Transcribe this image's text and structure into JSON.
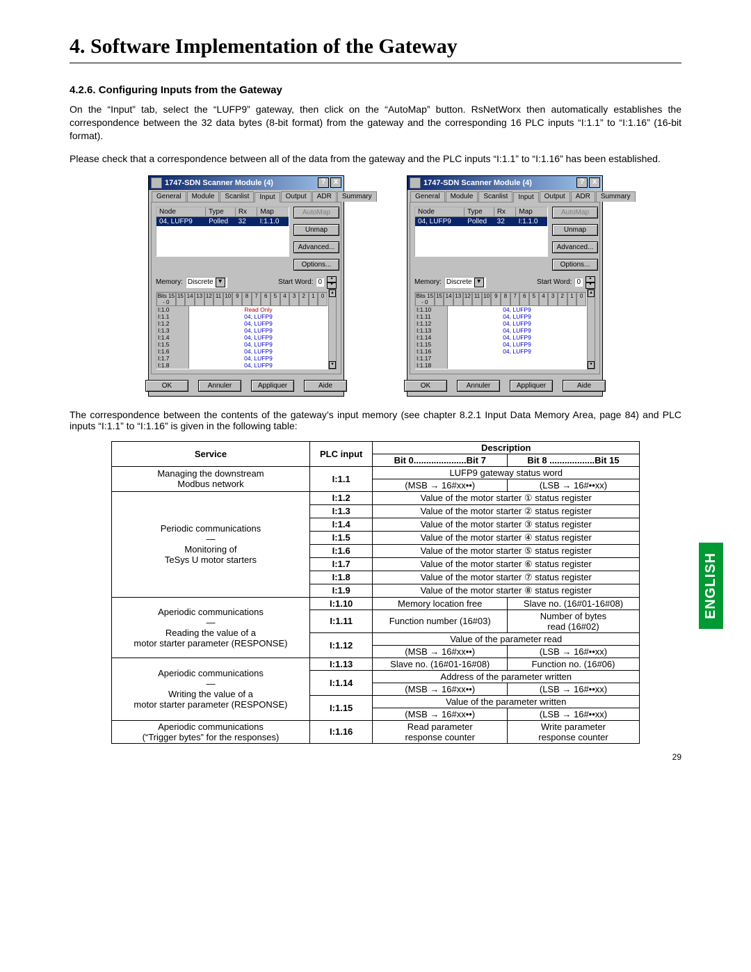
{
  "page_title": "4. Software Implementation of the Gateway",
  "section_title": "4.2.6. Configuring Inputs from the Gateway",
  "para1": "On the “Input” tab, select the “LUFP9” gateway, then click on the “AutoMap” button. RsNetWorx then automatically establishes the correspondence between the 32 data bytes (8-bit format) from the gateway and the corresponding 16 PLC inputs “I:1.1” to “I:1.16” (16-bit format).",
  "para2": "Please check that a correspondence between all of the data from the gateway and the PLC inputs “I:1.1” to “I:1.16” has been established.",
  "dialog_title": "1747-SDN Scanner Module (4)",
  "tabs": [
    "General",
    "Module",
    "Scanlist",
    "Input",
    "Output",
    "ADR",
    "Summary"
  ],
  "node_headers": [
    "Node",
    "Type",
    "Rx",
    "Map"
  ],
  "node_row": [
    "04, LUFP9",
    "Polled",
    "32",
    "I:1.1.0"
  ],
  "side_buttons": [
    "AutoMap",
    "Unmap",
    "Advanced...",
    "Options..."
  ],
  "memory_label": "Memory:",
  "memory_value": "Discrete",
  "startword_label": "Start Word:",
  "startword_value": "0",
  "bits_label": "Bits 15 - 0",
  "bits_cols": [
    "15",
    "14",
    "13",
    "12",
    "11",
    "10",
    "9",
    "8",
    "7",
    "6",
    "5",
    "4",
    "3",
    "2",
    "1",
    "0"
  ],
  "grid_left": [
    {
      "lab": "I:1.0",
      "val": "Read Only",
      "ro": true
    },
    {
      "lab": "I:1.1",
      "val": "04, LUFP9"
    },
    {
      "lab": "I:1.2",
      "val": "04, LUFP9"
    },
    {
      "lab": "I:1.3",
      "val": "04, LUFP9"
    },
    {
      "lab": "I:1.4",
      "val": "04, LUFP9"
    },
    {
      "lab": "I:1.5",
      "val": "04, LUFP9"
    },
    {
      "lab": "I:1.6",
      "val": "04, LUFP9"
    },
    {
      "lab": "I:1.7",
      "val": "04, LUFP9"
    },
    {
      "lab": "I:1.8",
      "val": "04, LUFP9"
    }
  ],
  "grid_right": [
    {
      "lab": "I:1.10",
      "val": "04, LUFP9"
    },
    {
      "lab": "I:1.11",
      "val": "04, LUFP9"
    },
    {
      "lab": "I:1.12",
      "val": "04, LUFP9"
    },
    {
      "lab": "I:1.13",
      "val": "04, LUFP9"
    },
    {
      "lab": "I:1.14",
      "val": "04, LUFP9"
    },
    {
      "lab": "I:1.15",
      "val": "04, LUFP9"
    },
    {
      "lab": "I:1.16",
      "val": "04, LUFP9"
    },
    {
      "lab": "I:1.17",
      "val": "",
      "empty": true
    },
    {
      "lab": "I:1.18",
      "val": "",
      "empty": true
    }
  ],
  "dlg_buttons": [
    "OK",
    "Annuler",
    "Appliquer",
    "Aide"
  ],
  "caption": "The correspondence between the contents of the gateway’s input memory (see chapter 8.2.1 Input Data Memory Area, page 84) and PLC inputs “I:1.1” to “I:1.16” is given in the following table:",
  "tbl": {
    "service_h": "Service",
    "plc_h": "PLC input",
    "desc_h": "Description",
    "bit07": "Bit 0.....................Bit 7",
    "bit815": "Bit 8 ..................Bit 15",
    "r1_svc": "Managing the downstream\nModbus network",
    "r1_plc": "I:1.1",
    "r1_top": "LUFP9 gateway status word",
    "r1_l": "(MSB → 16#xx••)",
    "r1_r": "(LSB → 16#••xx)",
    "r2_svc": "Periodic communications\n—\nMonitoring of\nTeSys U motor starters",
    "r2": [
      {
        "plc": "I:1.2",
        "d": "Value of the motor starter ① status register"
      },
      {
        "plc": "I:1.3",
        "d": "Value of the motor starter ② status register"
      },
      {
        "plc": "I:1.4",
        "d": "Value of the motor starter ③ status register"
      },
      {
        "plc": "I:1.5",
        "d": "Value of the motor starter ④ status register"
      },
      {
        "plc": "I:1.6",
        "d": "Value of the motor starter ⑤ status register"
      },
      {
        "plc": "I:1.7",
        "d": "Value of the motor starter ⑥ status register"
      },
      {
        "plc": "I:1.8",
        "d": "Value of the motor starter ⑦ status register"
      },
      {
        "plc": "I:1.9",
        "d": "Value of the motor starter ⑧ status register"
      }
    ],
    "r3_svc": "Aperiodic communications\n—\nReading the value of a\nmotor starter parameter (RESPONSE)",
    "r3_10_l": "Memory location free",
    "r3_10_r": "Slave no. (16#01-16#08)",
    "r3_10_plc": "I:1.10",
    "r3_11_l": "Function number (16#03)",
    "r3_11_r": "Number of bytes\nread (16#02)",
    "r3_11_plc": "I:1.11",
    "r3_12_top": "Value of the parameter read",
    "r3_12_plc": "I:1.12",
    "r3_12_l": "(MSB → 16#xx••)",
    "r3_12_r": "(LSB → 16#••xx)",
    "r4_svc": "Aperiodic communications\n—\nWriting the value of a\nmotor starter parameter (RESPONSE)",
    "r4_13_l": "Slave no. (16#01-16#08)",
    "r4_13_r": "Function no. (16#06)",
    "r4_13_plc": "I:1.13",
    "r4_14_top": "Address of the parameter written",
    "r4_14_plc": "I:1.14",
    "r4_14_l": "(MSB → 16#xx••)",
    "r4_14_r": "(LSB → 16#••xx)",
    "r4_15_top": "Value of the parameter written",
    "r4_15_plc": "I:1.15",
    "r4_15_l": "(MSB → 16#xx••)",
    "r4_15_r": "(LSB → 16#••xx)",
    "r5_svc": "Aperiodic communications\n(“Trigger bytes” for the responses)",
    "r5_plc": "I:1.16",
    "r5_l": "Read parameter\nresponse counter",
    "r5_r": "Write parameter\nresponse counter"
  },
  "english_tab": "ENGLISH",
  "page_number": "29"
}
